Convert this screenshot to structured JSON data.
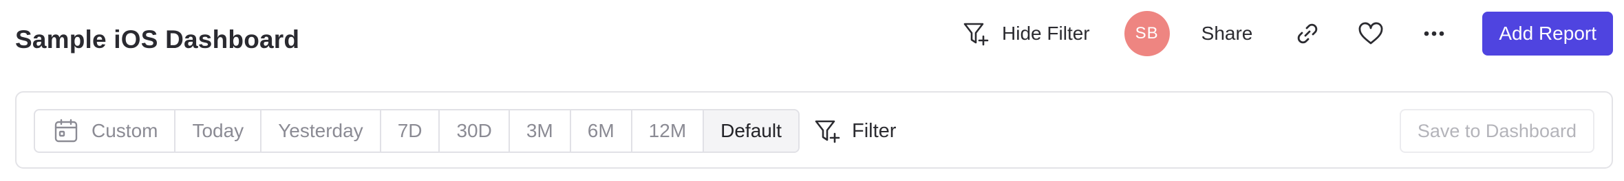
{
  "header": {
    "title": "Sample iOS Dashboard",
    "hide_filter_label": "Hide Filter",
    "avatar_initials": "SB",
    "share_label": "Share",
    "add_report_label": "Add Report",
    "icons": [
      "filter-add-icon",
      "link-icon",
      "heart-icon",
      "more-icon"
    ]
  },
  "filter_bar": {
    "date_ranges": [
      {
        "label": "Custom",
        "icon": "calendar-icon"
      },
      {
        "label": "Today"
      },
      {
        "label": "Yesterday"
      },
      {
        "label": "7D"
      },
      {
        "label": "30D"
      },
      {
        "label": "3M"
      },
      {
        "label": "6M"
      },
      {
        "label": "12M"
      },
      {
        "label": "Default",
        "selected": true
      }
    ],
    "filter_label": "Filter",
    "save_label": "Save to Dashboard"
  },
  "colors": {
    "primary": "#4f44e0",
    "avatar": "#ee8581",
    "text": "#2a2a30",
    "muted_text": "#8b8b94",
    "border": "#e1e1e6"
  }
}
